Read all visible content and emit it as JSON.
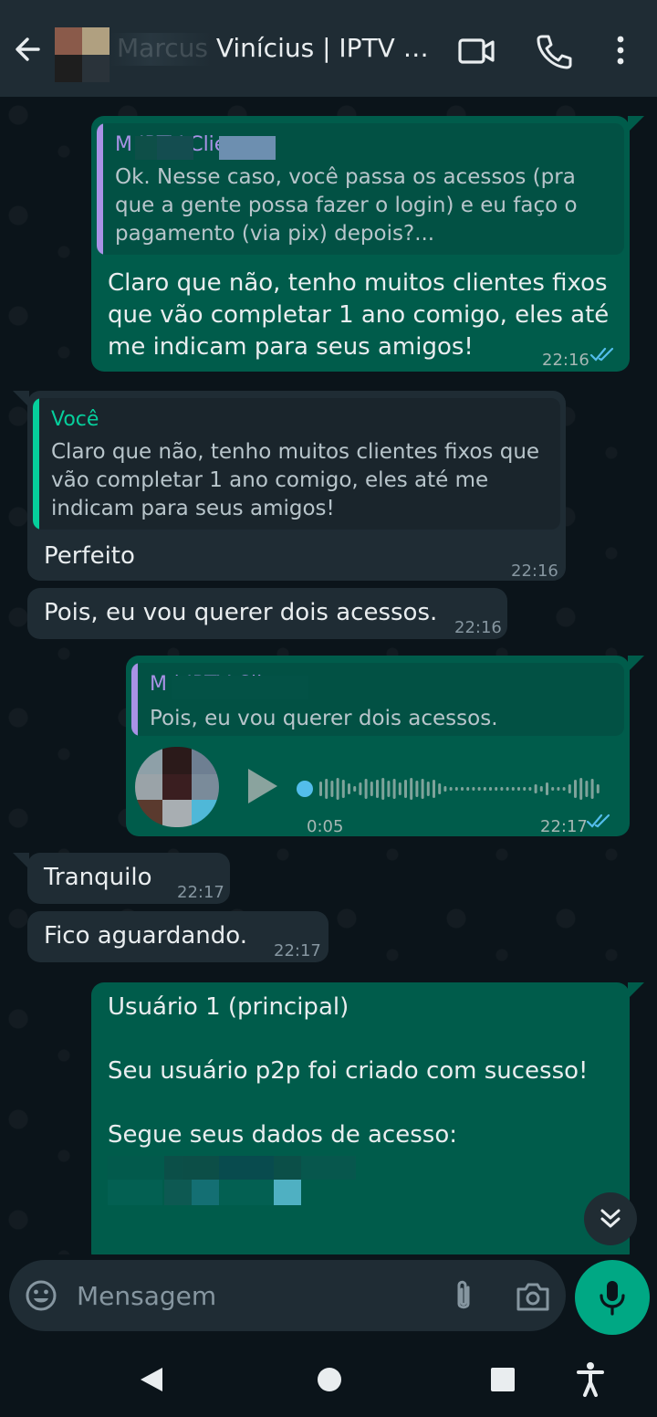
{
  "header": {
    "contact_name": "Marcus Vinícius | IPTV Cliente",
    "icons": [
      "back-arrow-icon",
      "video-call-icon",
      "phone-call-icon",
      "more-options-icon"
    ]
  },
  "messages": {
    "m1": {
      "quote_name": "M           IPTV Cliente",
      "quote_text": "Ok. Nesse caso, você passa os acessos (pra que a gente possa fazer o login) e eu faço o pagamento (via pix) depois?...",
      "text": "Claro que não, tenho muitos clientes fixos que vão completar 1 ano comigo, eles até me indicam para seus amigos!",
      "time": "22:16"
    },
    "m2": {
      "quote_name": "Você",
      "quote_text": "Claro que não, tenho muitos clientes fixos que vão completar 1 ano comigo, eles até me indicam para seus amigos!",
      "text": "Perfeito",
      "time": "22:16"
    },
    "m3": {
      "text": "Pois, eu vou querer dois acessos.",
      "time": "22:16"
    },
    "m4": {
      "quote_name": "M              | IPTV Cliente",
      "quote_text": "Pois, eu vou querer dois acessos.",
      "audio_duration": "0:05",
      "time": "22:17"
    },
    "m5": {
      "text": "Tranquilo",
      "time": "22:17"
    },
    "m6": {
      "text": "Fico aguardando.",
      "time": "22:17"
    },
    "m7": {
      "line1": "Usuário 1 (principal)",
      "line2": "Seu usuário p2p foi criado com sucesso!",
      "line3": "Segue seus dados de acesso:"
    }
  },
  "input": {
    "placeholder": "Mensagem"
  },
  "colors": {
    "outgoing": "#005c4b",
    "incoming": "#1f2c34",
    "accent": "#00a884",
    "quote_bar_purple": "#a992e6",
    "quote_bar_green": "#06cf9c",
    "read_tick": "#53bdeb"
  }
}
